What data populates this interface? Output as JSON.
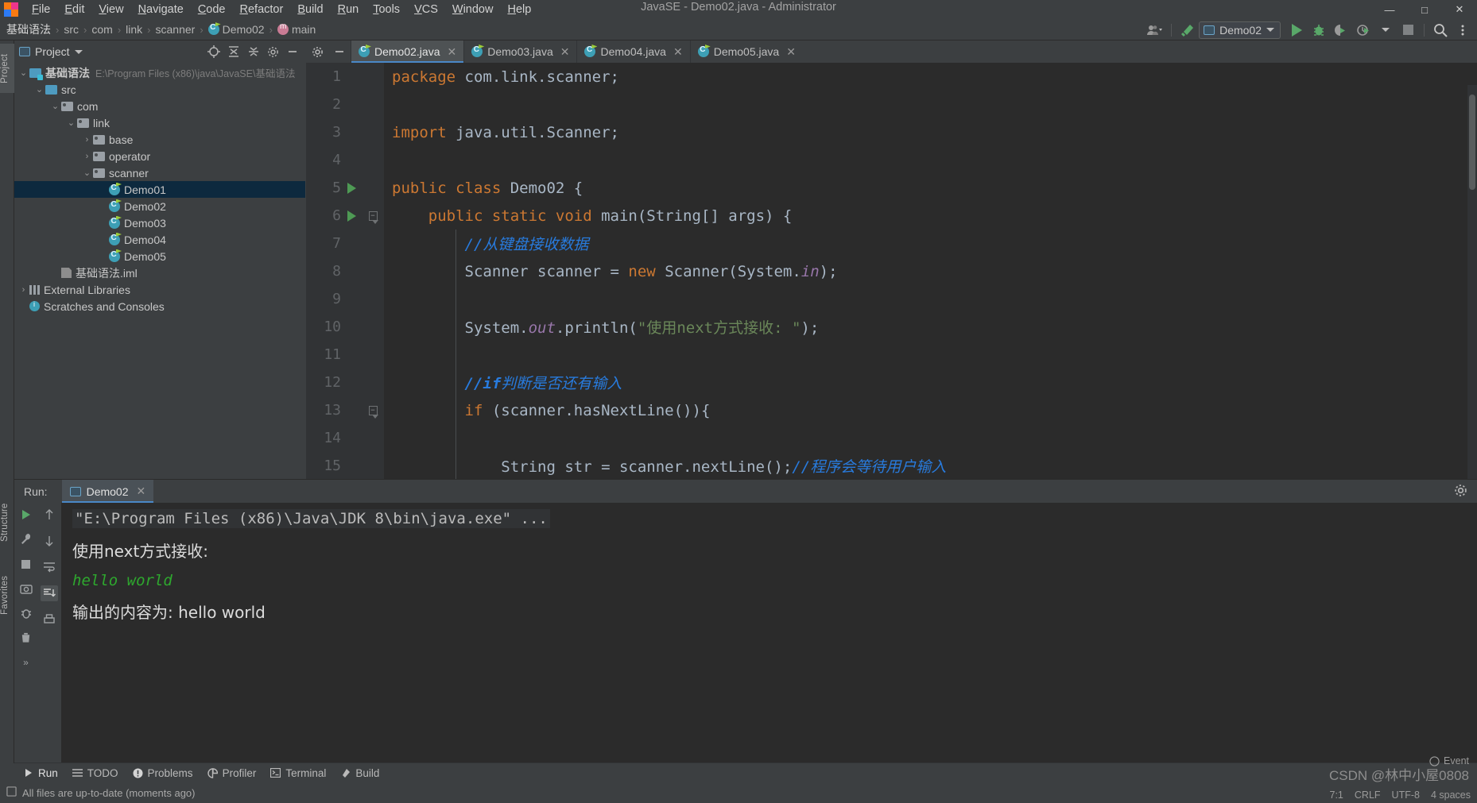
{
  "window": {
    "title": "JavaSE - Demo02.java - Administrator",
    "minimize": "—",
    "maximize": "□",
    "close": "✕"
  },
  "menu": {
    "items": [
      "File",
      "Edit",
      "View",
      "Navigate",
      "Code",
      "Refactor",
      "Build",
      "Run",
      "Tools",
      "VCS",
      "Window",
      "Help"
    ]
  },
  "breadcrumb": {
    "items": [
      {
        "label": "基础语法",
        "icon": "none"
      },
      {
        "label": "src",
        "icon": "none"
      },
      {
        "label": "com",
        "icon": "none"
      },
      {
        "label": "link",
        "icon": "none"
      },
      {
        "label": "scanner",
        "icon": "none"
      },
      {
        "label": "Demo02",
        "icon": "class-icon"
      },
      {
        "label": "main",
        "icon": "method-icon"
      }
    ],
    "separator": "›"
  },
  "toolbar": {
    "run_config": "Demo02",
    "icons": [
      "user-settings-icon",
      "build-hammer-icon",
      "run-icon",
      "debug-icon",
      "run-with-coverage-icon",
      "profiler-icon",
      "stop-icon",
      "search-icon",
      "more-icon"
    ]
  },
  "left_strip": {
    "tabs": [
      "Project",
      "Structure",
      "Favorites"
    ]
  },
  "project_panel": {
    "title": "Project",
    "header_icons": [
      "locate-icon",
      "expand-all-icon",
      "collapse-all-icon",
      "settings-icon",
      "hide-icon"
    ],
    "tree": [
      {
        "depth": 0,
        "chev": "⌄",
        "icon": "module-icon",
        "label": "基础语法",
        "path": "E:\\Program Files (x86)\\java\\JavaSE\\基础语法",
        "selected": false,
        "bold": true
      },
      {
        "depth": 1,
        "chev": "⌄",
        "icon": "source-folder-icon",
        "label": "src",
        "path": "",
        "selected": false,
        "bold": false
      },
      {
        "depth": 2,
        "chev": "⌄",
        "icon": "package-icon",
        "label": "com",
        "path": "",
        "selected": false,
        "bold": false
      },
      {
        "depth": 3,
        "chev": "⌄",
        "icon": "package-icon",
        "label": "link",
        "path": "",
        "selected": false,
        "bold": false
      },
      {
        "depth": 4,
        "chev": "›",
        "icon": "package-icon",
        "label": "base",
        "path": "",
        "selected": false,
        "bold": false
      },
      {
        "depth": 4,
        "chev": "›",
        "icon": "package-icon",
        "label": "operator",
        "path": "",
        "selected": false,
        "bold": false
      },
      {
        "depth": 4,
        "chev": "⌄",
        "icon": "package-icon",
        "label": "scanner",
        "path": "",
        "selected": false,
        "bold": false
      },
      {
        "depth": 5,
        "chev": "",
        "icon": "java-class-icon",
        "label": "Demo01",
        "path": "",
        "selected": true,
        "bold": false
      },
      {
        "depth": 5,
        "chev": "",
        "icon": "java-class-icon",
        "label": "Demo02",
        "path": "",
        "selected": false,
        "bold": false
      },
      {
        "depth": 5,
        "chev": "",
        "icon": "java-class-icon",
        "label": "Demo03",
        "path": "",
        "selected": false,
        "bold": false
      },
      {
        "depth": 5,
        "chev": "",
        "icon": "java-class-icon",
        "label": "Demo04",
        "path": "",
        "selected": false,
        "bold": false
      },
      {
        "depth": 5,
        "chev": "",
        "icon": "java-class-icon",
        "label": "Demo05",
        "path": "",
        "selected": false,
        "bold": false
      },
      {
        "depth": 2,
        "chev": "",
        "icon": "iml-file-icon",
        "label": "基础语法.iml",
        "path": "",
        "selected": false,
        "bold": false
      },
      {
        "depth": 0,
        "chev": "›",
        "icon": "library-icon",
        "label": "External Libraries",
        "path": "",
        "selected": false,
        "bold": false
      },
      {
        "depth": 0,
        "chev": "",
        "icon": "scratches-icon",
        "label": "Scratches and Consoles",
        "path": "",
        "selected": false,
        "bold": false
      }
    ]
  },
  "editor": {
    "tabs": [
      {
        "label": "Demo02.java",
        "active": true
      },
      {
        "label": "Demo03.java",
        "active": false
      },
      {
        "label": "Demo04.java",
        "active": false
      },
      {
        "label": "Demo05.java",
        "active": false
      }
    ],
    "close_glyph": "✕",
    "lines": [
      {
        "n": "1",
        "gutter": "",
        "fold": "",
        "html": "<span class='k'>package</span><span class='t'> com.link.scanner;</span>"
      },
      {
        "n": "2",
        "gutter": "",
        "fold": "",
        "html": ""
      },
      {
        "n": "3",
        "gutter": "",
        "fold": "",
        "html": "<span class='k'>import</span><span class='t'> java.util.Scanner;</span>"
      },
      {
        "n": "4",
        "gutter": "",
        "fold": "",
        "html": ""
      },
      {
        "n": "5",
        "gutter": "run",
        "fold": "",
        "html": "<span class='k'>public class </span><span class='t'>Demo02 {</span>"
      },
      {
        "n": "6",
        "gutter": "run",
        "fold": "fold",
        "html": "<span class='t'>    </span><span class='k'>public static void </span><span class='t'>main(String[] args) {</span>"
      },
      {
        "n": "7",
        "gutter": "",
        "fold": "",
        "html": "<span class='cm'>        //从键盘接收数据</span>"
      },
      {
        "n": "8",
        "gutter": "",
        "fold": "",
        "html": "<span class='t'>        Scanner scanner = </span><span class='k'>new </span><span class='t'>Scanner(System.</span><span class='f'>in</span><span class='t'>);</span>"
      },
      {
        "n": "9",
        "gutter": "",
        "fold": "",
        "html": ""
      },
      {
        "n": "10",
        "gutter": "",
        "fold": "",
        "html": "<span class='t'>        System.</span><span class='f'>out</span><span class='t'>.println(</span><span class='s'>\"使用next方式接收: \"</span><span class='t'>);</span>"
      },
      {
        "n": "11",
        "gutter": "",
        "fold": "",
        "html": ""
      },
      {
        "n": "12",
        "gutter": "",
        "fold": "",
        "html": "<span class='cmb'>        //if</span><span class='cm'>判断是否还有输入</span>"
      },
      {
        "n": "13",
        "gutter": "",
        "fold": "fold2",
        "html": "<span class='t'>        </span><span class='k'>if </span><span class='t'>(scanner.hasNextLine()){</span>"
      },
      {
        "n": "14",
        "gutter": "",
        "fold": "",
        "html": ""
      },
      {
        "n": "15",
        "gutter": "",
        "fold": "",
        "html": "<span class='t'>            String str = scanner.nextLine();</span><span class='cm'>//程序会等待用户输入</span>"
      }
    ]
  },
  "run_panel": {
    "label": "Run:",
    "tab": "Demo02",
    "close_glyph": "✕",
    "tool_icons": [
      "rerun-icon",
      "settings-wrench-icon",
      "stop-icon",
      "camera-icon",
      "bug-icon",
      "trash-icon",
      "expand-icon"
    ],
    "tool_icons2": [
      "scroll-up-icon",
      "scroll-down-icon",
      "soft-wrap-icon",
      "scroll-to-end-icon",
      "print-icon"
    ],
    "console": [
      {
        "type": "cmd",
        "text": "\"E:\\Program Files (x86)\\Java\\JDK 8\\bin\\java.exe\" ..."
      },
      {
        "type": "cn",
        "text": "使用next方式接收:"
      },
      {
        "type": "input",
        "text": "hello world"
      },
      {
        "type": "cn",
        "text": "输出的内容为: hello world"
      }
    ]
  },
  "bottom_tabs": [
    {
      "label": "Run",
      "icon": "run-icon",
      "selected": true
    },
    {
      "label": "TODO",
      "icon": "todo-icon",
      "selected": false
    },
    {
      "label": "Problems",
      "icon": "problems-icon",
      "selected": false
    },
    {
      "label": "Profiler",
      "icon": "profiler-icon",
      "selected": false
    },
    {
      "label": "Terminal",
      "icon": "terminal-icon",
      "selected": false
    },
    {
      "label": "Build",
      "icon": "build-icon",
      "selected": false
    }
  ],
  "status": {
    "message": "All files are up-to-date (moments ago)",
    "caret": "7:1",
    "line_sep": "CRLF",
    "encoding": "UTF-8",
    "indent": "4 spaces",
    "event_log": "Event",
    "watermark": "CSDN @林中小屋0808"
  },
  "colors": {
    "accent": "#4a88c7",
    "selection": "#0d293e",
    "keyword": "#cc7832",
    "string": "#6a8759",
    "comment": "#287bde",
    "field": "#9876aa",
    "run_green": "#59a869",
    "console_input": "#2ea82e"
  }
}
